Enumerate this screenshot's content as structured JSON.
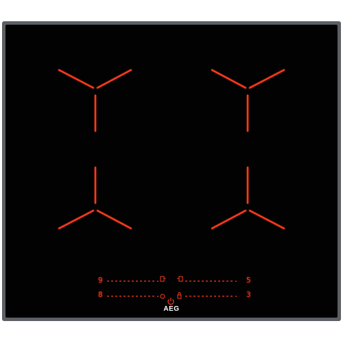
{
  "cooktop": {
    "brand_logo": "AEG",
    "zone_colors": {
      "glow": "#ff3a1a",
      "glass": "#020203",
      "frame": "#5c5f63"
    },
    "controls": {
      "top_left_level": "9",
      "top_right_level": "5",
      "bottom_left_level": "8",
      "bottom_right_level": "3"
    },
    "icons": [
      "power-icon",
      "bridge-left-icon",
      "bridge-right-icon",
      "timer-icon",
      "lock-icon",
      "pause-icon"
    ]
  }
}
